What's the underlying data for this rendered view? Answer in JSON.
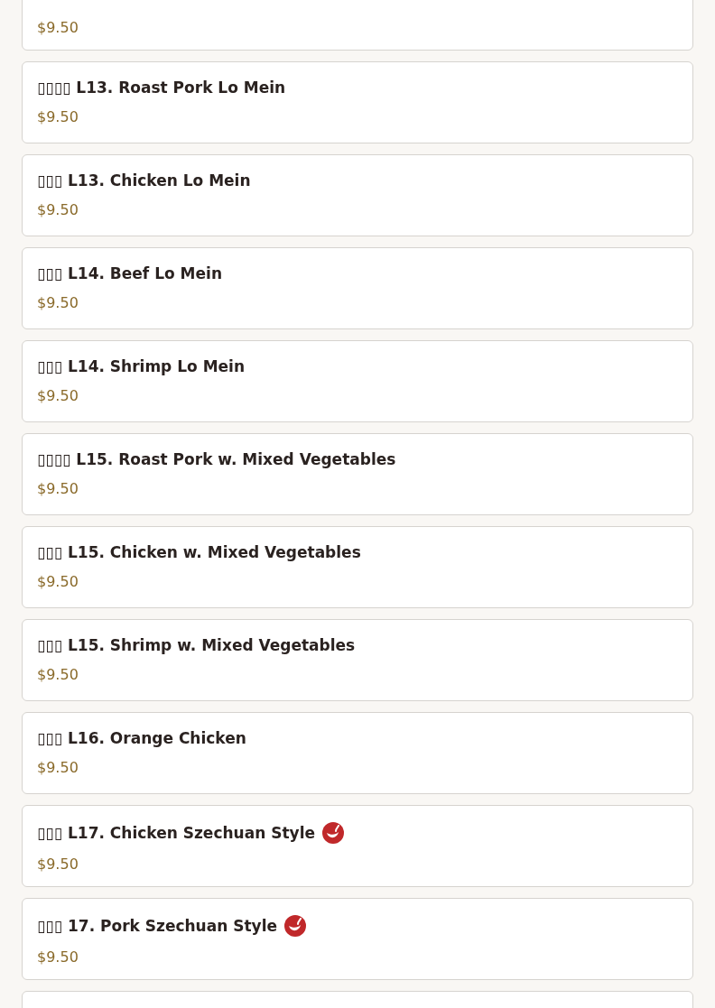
{
  "menu_items": [
    {
      "price": "$9.50"
    },
    {
      "name": "▯▯▯▯ L13. Roast Pork Lo Mein",
      "price": "$9.50",
      "spicy": false
    },
    {
      "name": "▯▯▯ L13. Chicken Lo Mein",
      "price": "$9.50",
      "spicy": false
    },
    {
      "name": "▯▯▯ L14. Beef Lo Mein",
      "price": "$9.50",
      "spicy": false
    },
    {
      "name": "▯▯▯ L14. Shrimp Lo Mein",
      "price": "$9.50",
      "spicy": false
    },
    {
      "name": "▯▯▯▯ L15. Roast Pork w. Mixed Vegetables",
      "price": "$9.50",
      "spicy": false
    },
    {
      "name": "▯▯▯ L15. Chicken w. Mixed Vegetables",
      "price": "$9.50",
      "spicy": false
    },
    {
      "name": "▯▯▯ L15. Shrimp w. Mixed Vegetables",
      "price": "$9.50",
      "spicy": false
    },
    {
      "name": "▯▯▯ L16. Orange Chicken",
      "price": "$9.50",
      "spicy": false
    },
    {
      "name": "▯▯▯ L17. Chicken Szechuan Style",
      "price": "$9.50",
      "spicy": true
    },
    {
      "name": "▯▯▯ 17. Pork Szechuan Style",
      "price": "$9.50",
      "spicy": true
    }
  ]
}
